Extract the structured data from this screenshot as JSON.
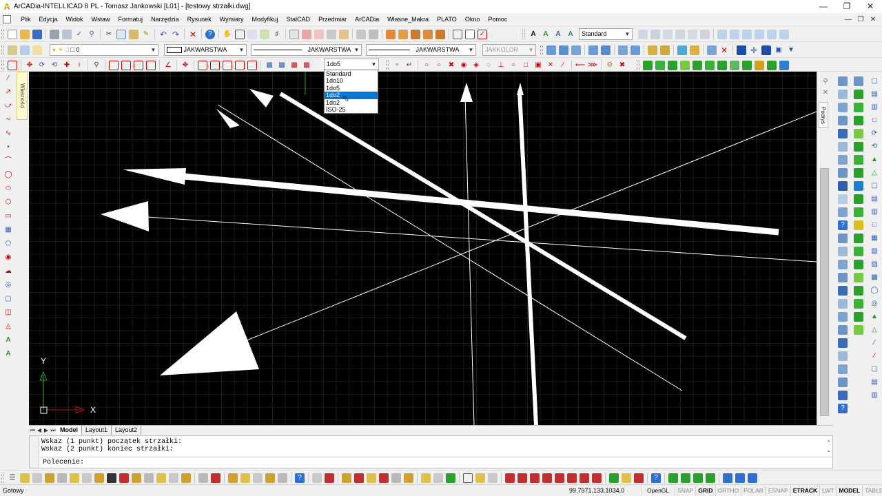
{
  "title_bar": {
    "title": "ArCADia-INTELLICAD 8 PL - Tomasz Jankowski [L01] - [testowy strzałki.dwg]",
    "buttons": [
      "minimize",
      "maximize",
      "close"
    ]
  },
  "menu": {
    "items": [
      "Plik",
      "Edycja",
      "Widok",
      "Wstaw",
      "Formatuj",
      "Narzędzia",
      "Rysunek",
      "Wymiary",
      "Modyfikuj",
      "StalCAD",
      "Przedmiar",
      "ArCADia",
      "Własne_Makra",
      "PLATO",
      "Okno",
      "Pomoc"
    ]
  },
  "toolbars": {
    "text_style": "Standard",
    "layer": "0",
    "color": "JAKWARSTWA",
    "linetype": "JAKWARSTWA",
    "lineweight": "JAKWARSTWA",
    "plot_style": "JAKKOLOR",
    "dim_style": "1do5"
  },
  "dim_style_dropdown": {
    "options": [
      "Standard",
      "1do10",
      "1do5",
      "1do2",
      "1do2",
      "ISO-25"
    ],
    "highlighted_index": 3
  },
  "properties_tab": {
    "label": "Własności"
  },
  "drawing_tab": {
    "label": "Podrys"
  },
  "ucs": {
    "x_label": "X",
    "y_label": "Y"
  },
  "layout_tabs": [
    "Model",
    "Layout1",
    "Layout2"
  ],
  "command": {
    "history": [
      "Wskaz (1 punkt) początek strzałki:",
      "Wskaz (2 punkt) koniec strzałki:"
    ],
    "prompt": "Polecenie:"
  },
  "status": {
    "ready_text": "Gotowy",
    "coordinates": "99.7971,133.1034,0",
    "renderer": "OpenGL",
    "toggles": [
      {
        "label": "SNAP",
        "on": false
      },
      {
        "label": "GRID",
        "on": true
      },
      {
        "label": "ORTHO",
        "on": false
      },
      {
        "label": "POLAR",
        "on": false
      },
      {
        "label": "ESNAP",
        "on": false
      },
      {
        "label": "ETRACK",
        "on": true
      },
      {
        "label": "LWT",
        "on": false
      },
      {
        "label": "MODEL",
        "on": true
      },
      {
        "label": "TABLET",
        "on": false
      }
    ]
  },
  "colors": {
    "canvas_background": "#000000",
    "grid": "#1c1c1c",
    "entities": "#ffffff",
    "selection": "#0078d7"
  }
}
